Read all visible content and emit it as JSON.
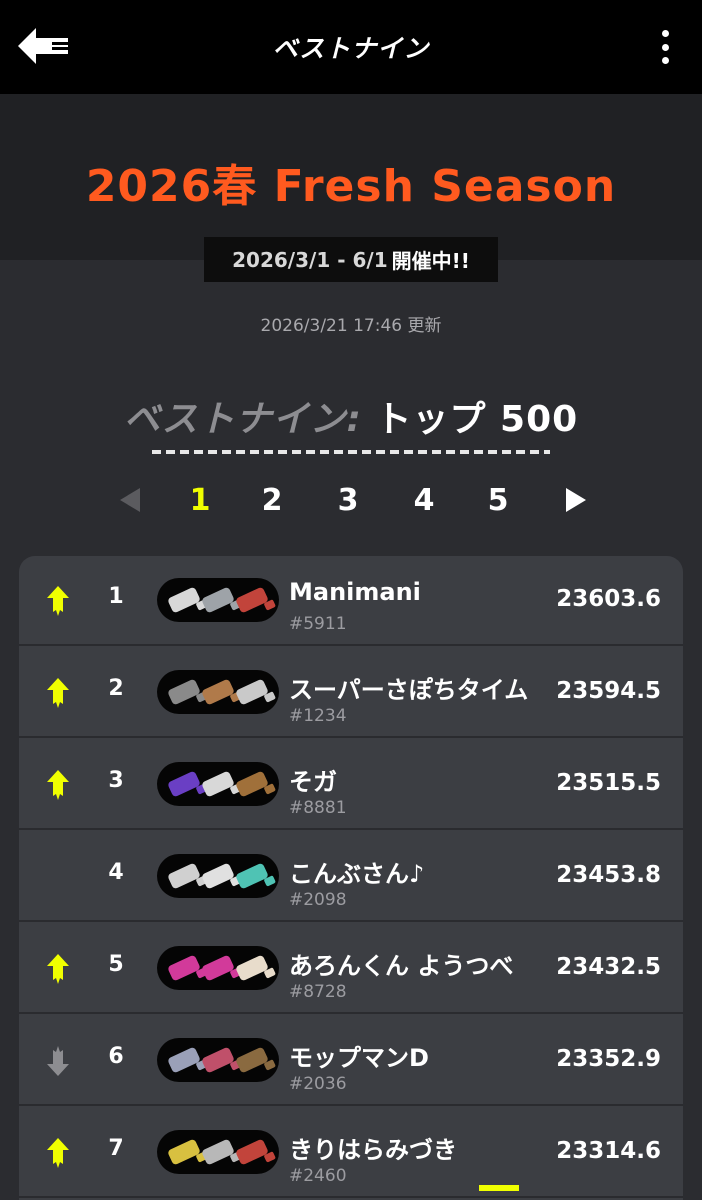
{
  "topbar": {
    "title": "ベストナイン"
  },
  "season": {
    "title": "2026春 Fresh Season",
    "dates": "2026/3/1 - 6/1",
    "status": "開催中!!"
  },
  "updated": "2026/3/21 17:46 更新",
  "section": {
    "label_muted": "ベストナイン:",
    "label_strong": "トップ 500"
  },
  "pager": {
    "pages": [
      "1",
      "2",
      "3",
      "4",
      "5"
    ],
    "active": "1"
  },
  "colors": {
    "accent_orange": "#ff5a1f",
    "accent_yellow": "#f0ff00",
    "trend_down": "#8d8d91"
  },
  "rankings": [
    {
      "rank": "1",
      "name": "Manimani",
      "tag": "#5911",
      "score": "23603.6",
      "trend": "up"
    },
    {
      "rank": "2",
      "name": "スーパーさぽちタイム",
      "tag": "#1234",
      "score": "23594.5",
      "trend": "up"
    },
    {
      "rank": "3",
      "name": "そガ",
      "tag": "#8881",
      "score": "23515.5",
      "trend": "up"
    },
    {
      "rank": "4",
      "name": "こんぶさん♪",
      "tag": "#2098",
      "score": "23453.8",
      "trend": "none"
    },
    {
      "rank": "5",
      "name": "あろんくん ようつべ",
      "tag": "#8728",
      "score": "23432.5",
      "trend": "up"
    },
    {
      "rank": "6",
      "name": "モップマンD",
      "tag": "#2036",
      "score": "23352.9",
      "trend": "down"
    },
    {
      "rank": "7",
      "name": "きりはらみづき",
      "tag": "#2460",
      "score": "23314.6",
      "trend": "up"
    }
  ]
}
